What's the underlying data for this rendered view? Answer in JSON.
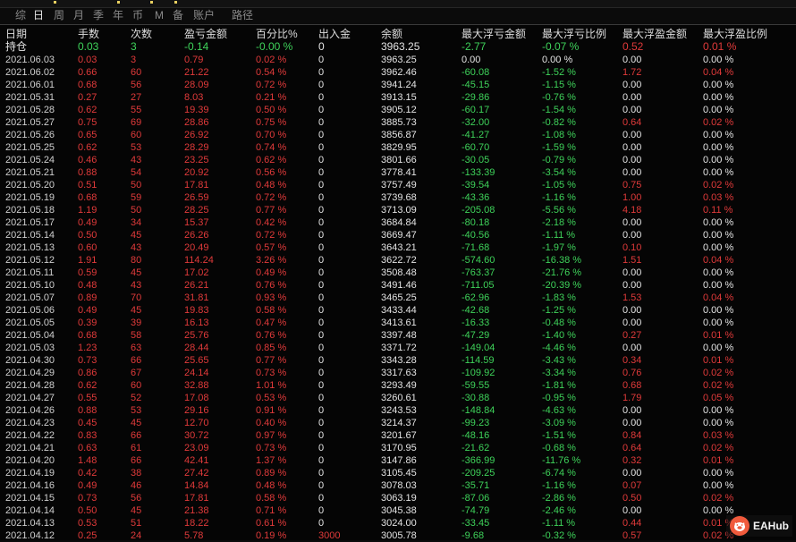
{
  "tabs": [
    "综",
    "日",
    "周",
    "月",
    "季",
    "年",
    "币",
    "M",
    "备",
    "账户",
    "路径"
  ],
  "active_tab": 1,
  "headers": [
    "日期",
    "手数",
    "次数",
    "盈亏金额",
    "百分比%",
    "出入金",
    "余额",
    "最大浮亏金额",
    "最大浮亏比例",
    "最大浮盈金额",
    "最大浮盈比例"
  ],
  "holding": [
    "持仓",
    "0.03",
    "3",
    "-0.14",
    "-0.00 %",
    "0",
    "3963.25",
    "-2.77",
    "-0.07 %",
    "0.52",
    "0.01 %"
  ],
  "rows": [
    [
      "2021.06.03",
      "0.03",
      "3",
      "0.79",
      "0.02 %",
      "0",
      "3963.25",
      "0.00",
      "0.00 %",
      "0.00",
      "0.00 %"
    ],
    [
      "2021.06.02",
      "0.66",
      "60",
      "21.22",
      "0.54 %",
      "0",
      "3962.46",
      "-60.08",
      "-1.52 %",
      "1.72",
      "0.04 %"
    ],
    [
      "2021.06.01",
      "0.68",
      "56",
      "28.09",
      "0.72 %",
      "0",
      "3941.24",
      "-45.15",
      "-1.15 %",
      "0.00",
      "0.00 %"
    ],
    [
      "2021.05.31",
      "0.27",
      "27",
      "8.03",
      "0.21 %",
      "0",
      "3913.15",
      "-29.86",
      "-0.76 %",
      "0.00",
      "0.00 %"
    ],
    [
      "2021.05.28",
      "0.62",
      "55",
      "19.39",
      "0.50 %",
      "0",
      "3905.12",
      "-60.17",
      "-1.54 %",
      "0.00",
      "0.00 %"
    ],
    [
      "2021.05.27",
      "0.75",
      "69",
      "28.86",
      "0.75 %",
      "0",
      "3885.73",
      "-32.00",
      "-0.82 %",
      "0.64",
      "0.02 %"
    ],
    [
      "2021.05.26",
      "0.65",
      "60",
      "26.92",
      "0.70 %",
      "0",
      "3856.87",
      "-41.27",
      "-1.08 %",
      "0.00",
      "0.00 %"
    ],
    [
      "2021.05.25",
      "0.62",
      "53",
      "28.29",
      "0.74 %",
      "0",
      "3829.95",
      "-60.70",
      "-1.59 %",
      "0.00",
      "0.00 %"
    ],
    [
      "2021.05.24",
      "0.46",
      "43",
      "23.25",
      "0.62 %",
      "0",
      "3801.66",
      "-30.05",
      "-0.79 %",
      "0.00",
      "0.00 %"
    ],
    [
      "2021.05.21",
      "0.88",
      "54",
      "20.92",
      "0.56 %",
      "0",
      "3778.41",
      "-133.39",
      "-3.54 %",
      "0.00",
      "0.00 %"
    ],
    [
      "2021.05.20",
      "0.51",
      "50",
      "17.81",
      "0.48 %",
      "0",
      "3757.49",
      "-39.54",
      "-1.05 %",
      "0.75",
      "0.02 %"
    ],
    [
      "2021.05.19",
      "0.68",
      "59",
      "26.59",
      "0.72 %",
      "0",
      "3739.68",
      "-43.36",
      "-1.16 %",
      "1.00",
      "0.03 %"
    ],
    [
      "2021.05.18",
      "1.19",
      "50",
      "28.25",
      "0.77 %",
      "0",
      "3713.09",
      "-205.08",
      "-5.56 %",
      "4.18",
      "0.11 %"
    ],
    [
      "2021.05.17",
      "0.49",
      "34",
      "15.37",
      "0.42 %",
      "0",
      "3684.84",
      "-80.18",
      "-2.18 %",
      "0.00",
      "0.00 %"
    ],
    [
      "2021.05.14",
      "0.50",
      "45",
      "26.26",
      "0.72 %",
      "0",
      "3669.47",
      "-40.56",
      "-1.11 %",
      "0.00",
      "0.00 %"
    ],
    [
      "2021.05.13",
      "0.60",
      "43",
      "20.49",
      "0.57 %",
      "0",
      "3643.21",
      "-71.68",
      "-1.97 %",
      "0.10",
      "0.00 %"
    ],
    [
      "2021.05.12",
      "1.91",
      "80",
      "114.24",
      "3.26 %",
      "0",
      "3622.72",
      "-574.60",
      "-16.38 %",
      "1.51",
      "0.04 %"
    ],
    [
      "2021.05.11",
      "0.59",
      "45",
      "17.02",
      "0.49 %",
      "0",
      "3508.48",
      "-763.37",
      "-21.76 %",
      "0.00",
      "0.00 %"
    ],
    [
      "2021.05.10",
      "0.48",
      "43",
      "26.21",
      "0.76 %",
      "0",
      "3491.46",
      "-711.05",
      "-20.39 %",
      "0.00",
      "0.00 %"
    ],
    [
      "2021.05.07",
      "0.89",
      "70",
      "31.81",
      "0.93 %",
      "0",
      "3465.25",
      "-62.96",
      "-1.83 %",
      "1.53",
      "0.04 %"
    ],
    [
      "2021.05.06",
      "0.49",
      "45",
      "19.83",
      "0.58 %",
      "0",
      "3433.44",
      "-42.68",
      "-1.25 %",
      "0.00",
      "0.00 %"
    ],
    [
      "2021.05.05",
      "0.39",
      "39",
      "16.13",
      "0.47 %",
      "0",
      "3413.61",
      "-16.33",
      "-0.48 %",
      "0.00",
      "0.00 %"
    ],
    [
      "2021.05.04",
      "0.68",
      "58",
      "25.76",
      "0.76 %",
      "0",
      "3397.48",
      "-47.29",
      "-1.40 %",
      "0.27",
      "0.01 %"
    ],
    [
      "2021.05.03",
      "1.23",
      "63",
      "28.44",
      "0.85 %",
      "0",
      "3371.72",
      "-149.04",
      "-4.46 %",
      "0.00",
      "0.00 %"
    ],
    [
      "2021.04.30",
      "0.73",
      "66",
      "25.65",
      "0.77 %",
      "0",
      "3343.28",
      "-114.59",
      "-3.43 %",
      "0.34",
      "0.01 %"
    ],
    [
      "2021.04.29",
      "0.86",
      "67",
      "24.14",
      "0.73 %",
      "0",
      "3317.63",
      "-109.92",
      "-3.34 %",
      "0.76",
      "0.02 %"
    ],
    [
      "2021.04.28",
      "0.62",
      "60",
      "32.88",
      "1.01 %",
      "0",
      "3293.49",
      "-59.55",
      "-1.81 %",
      "0.68",
      "0.02 %"
    ],
    [
      "2021.04.27",
      "0.55",
      "52",
      "17.08",
      "0.53 %",
      "0",
      "3260.61",
      "-30.88",
      "-0.95 %",
      "1.79",
      "0.05 %"
    ],
    [
      "2021.04.26",
      "0.88",
      "53",
      "29.16",
      "0.91 %",
      "0",
      "3243.53",
      "-148.84",
      "-4.63 %",
      "0.00",
      "0.00 %"
    ],
    [
      "2021.04.23",
      "0.45",
      "45",
      "12.70",
      "0.40 %",
      "0",
      "3214.37",
      "-99.23",
      "-3.09 %",
      "0.00",
      "0.00 %"
    ],
    [
      "2021.04.22",
      "0.83",
      "66",
      "30.72",
      "0.97 %",
      "0",
      "3201.67",
      "-48.16",
      "-1.51 %",
      "0.84",
      "0.03 %"
    ],
    [
      "2021.04.21",
      "0.63",
      "61",
      "23.09",
      "0.73 %",
      "0",
      "3170.95",
      "-21.62",
      "-0.68 %",
      "0.64",
      "0.02 %"
    ],
    [
      "2021.04.20",
      "1.48",
      "66",
      "42.41",
      "1.37 %",
      "0",
      "3147.86",
      "-366.99",
      "-11.76 %",
      "0.32",
      "0.01 %"
    ],
    [
      "2021.04.19",
      "0.42",
      "38",
      "27.42",
      "0.89 %",
      "0",
      "3105.45",
      "-209.25",
      "-6.74 %",
      "0.00",
      "0.00 %"
    ],
    [
      "2021.04.16",
      "0.49",
      "46",
      "14.84",
      "0.48 %",
      "0",
      "3078.03",
      "-35.71",
      "-1.16 %",
      "0.07",
      "0.00 %"
    ],
    [
      "2021.04.15",
      "0.73",
      "56",
      "17.81",
      "0.58 %",
      "0",
      "3063.19",
      "-87.06",
      "-2.86 %",
      "0.50",
      "0.02 %"
    ],
    [
      "2021.04.14",
      "0.50",
      "45",
      "21.38",
      "0.71 %",
      "0",
      "3045.38",
      "-74.79",
      "-2.46 %",
      "0.00",
      "0.00 %"
    ],
    [
      "2021.04.13",
      "0.53",
      "51",
      "18.22",
      "0.61 %",
      "0",
      "3024.00",
      "-33.45",
      "-1.11 %",
      "0.44",
      "0.01 %"
    ],
    [
      "2021.04.12",
      "0.25",
      "24",
      "5.78",
      "0.19 %",
      "3000",
      "3005.78",
      "-9.68",
      "-0.32 %",
      "0.57",
      "0.02 %"
    ]
  ],
  "colors": {
    "profit": "#e03a3a",
    "loss": "#3ed25a",
    "neutral": "#e4e4e4",
    "background": "#050505"
  },
  "watermark": {
    "text": "EAHub",
    "icon": "pig-logo-icon"
  }
}
